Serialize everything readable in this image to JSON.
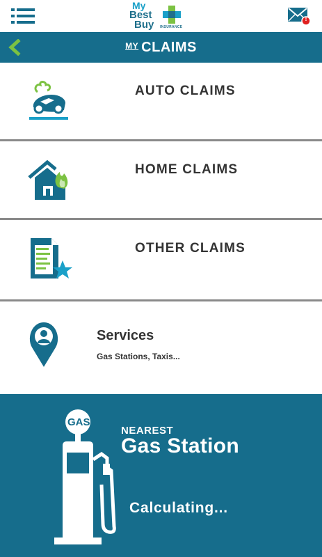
{
  "header": {
    "logo": {
      "line1": "My",
      "line2": "Best",
      "line3": "Buy",
      "sub": "INSURANCE"
    },
    "menu_icon": "menu-list-icon",
    "mail_icon": "mail-icon",
    "notification_badge": "!"
  },
  "titlebar": {
    "back_icon": "chevron-left-icon",
    "title_prefix": "MY",
    "title": "CLAIMS"
  },
  "claims": [
    {
      "label": "AUTO CLAIMS",
      "icon": "car-crash-icon"
    },
    {
      "label": "HOME CLAIMS",
      "icon": "house-fire-icon"
    },
    {
      "label": "OTHER CLAIMS",
      "icon": "document-star-icon"
    }
  ],
  "services": {
    "title": "Services",
    "subtitle": "Gas Stations, Taxis...",
    "icon": "map-pin-person-icon"
  },
  "gas_panel": {
    "heading_small": "NEAREST",
    "heading": "Gas Station",
    "status": "Calculating...",
    "pump_label": "GAS",
    "icon": "gas-pump-icon"
  },
  "colors": {
    "primary": "#166d8c",
    "accent_green": "#7cc242",
    "accent_blue": "#1aa0c8",
    "text": "#333333",
    "divider": "#8a8a8a",
    "badge": "#e02020"
  }
}
